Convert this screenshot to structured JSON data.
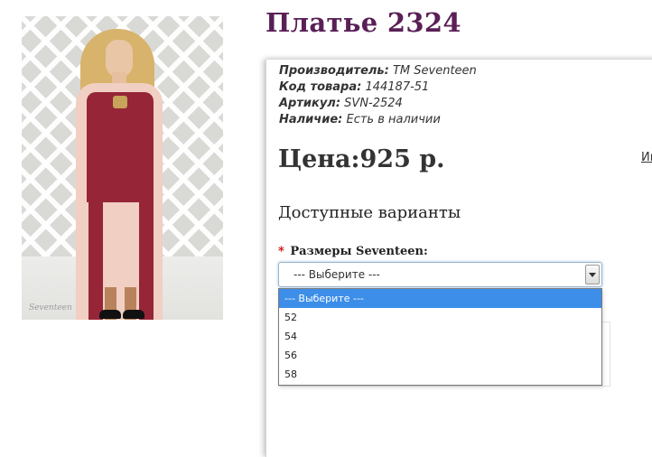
{
  "product": {
    "title": "Платье 2324",
    "photo_watermark": "Seventeen"
  },
  "details": {
    "manufacturer_label": "Производитель:",
    "manufacturer_value": "TM Seventeen",
    "code_label": "Код товара:",
    "code_value": "144187-51",
    "article_label": "Артикул:",
    "article_value": "SVN-2524",
    "availability_label": "Наличие:",
    "availability_value": "Есть в наличии"
  },
  "price": {
    "text": "Цена:925 р."
  },
  "side_link": "Ин",
  "variants": {
    "heading": "Доступные варианты",
    "required_mark": "*",
    "size_label": "Размеры Seventeen:",
    "selected": "--- Выберите ---",
    "options": [
      "--- Выберите ---",
      "52",
      "54",
      "56",
      "58"
    ]
  },
  "colors": {
    "title": "#5a1f57",
    "highlight": "#3d8ee8",
    "dress_accent": "#962538"
  }
}
